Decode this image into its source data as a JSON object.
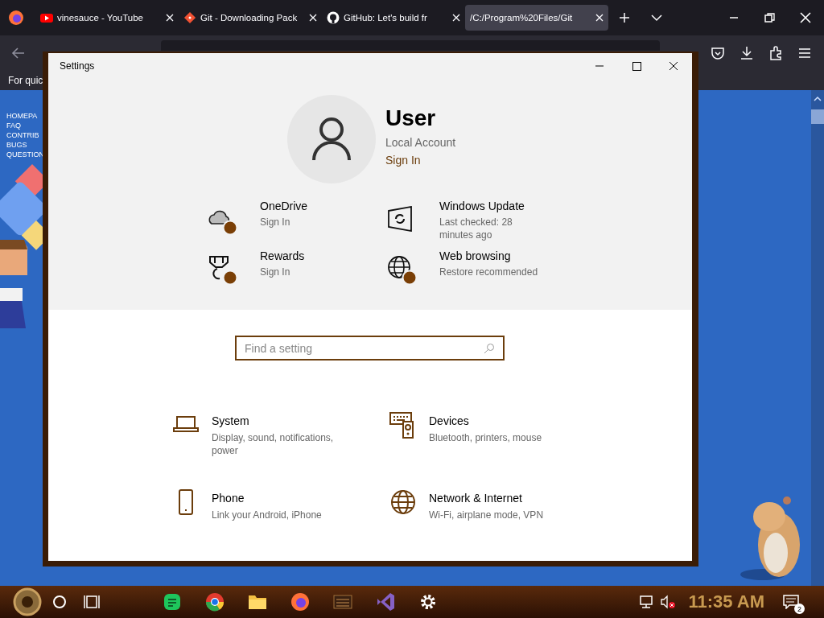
{
  "browser": {
    "tabs": [
      {
        "title": "vinesauce - YouTube",
        "kind": "youtube",
        "selected": false
      },
      {
        "title": "Git - Downloading Pack",
        "kind": "git",
        "selected": false
      },
      {
        "title": "GitHub: Let's build fr",
        "kind": "github",
        "selected": false
      },
      {
        "title": "/C:/Program%20Files/Git",
        "kind": "file",
        "selected": true
      }
    ],
    "bookmarks_text": "For quic"
  },
  "page": {
    "nav_links": [
      "HOMEPA",
      "FAQ",
      "CONTRIB",
      "BUGS",
      "QUESTION"
    ]
  },
  "settings": {
    "title": "Settings",
    "user": {
      "name": "User",
      "account": "Local Account",
      "sign_in": "Sign In"
    },
    "services": [
      {
        "title": "OneDrive",
        "subtitle": "Sign In",
        "kind": "cloud",
        "badge": true
      },
      {
        "title": "Windows Update",
        "subtitle": "Last checked: 28 minutes ago",
        "kind": "update",
        "badge": false
      },
      {
        "title": "Rewards",
        "subtitle": "Sign In",
        "kind": "medal",
        "badge": true
      },
      {
        "title": "Web browsing",
        "subtitle": "Restore recommended",
        "kind": "globe",
        "badge": true
      }
    ],
    "search": {
      "placeholder": "Find a setting"
    },
    "categories": [
      {
        "title": "System",
        "description": "Display, sound, notifications, power",
        "kind": "laptop"
      },
      {
        "title": "Devices",
        "description": "Bluetooth, printers, mouse",
        "kind": "devices"
      },
      {
        "title": "Phone",
        "description": "Link your Android, iPhone",
        "kind": "phone"
      },
      {
        "title": "Network & Internet",
        "description": "Wi-Fi, airplane mode, VPN",
        "kind": "globe"
      }
    ]
  },
  "taskbar": {
    "time": "11:35 AM",
    "notifications": "2"
  }
}
